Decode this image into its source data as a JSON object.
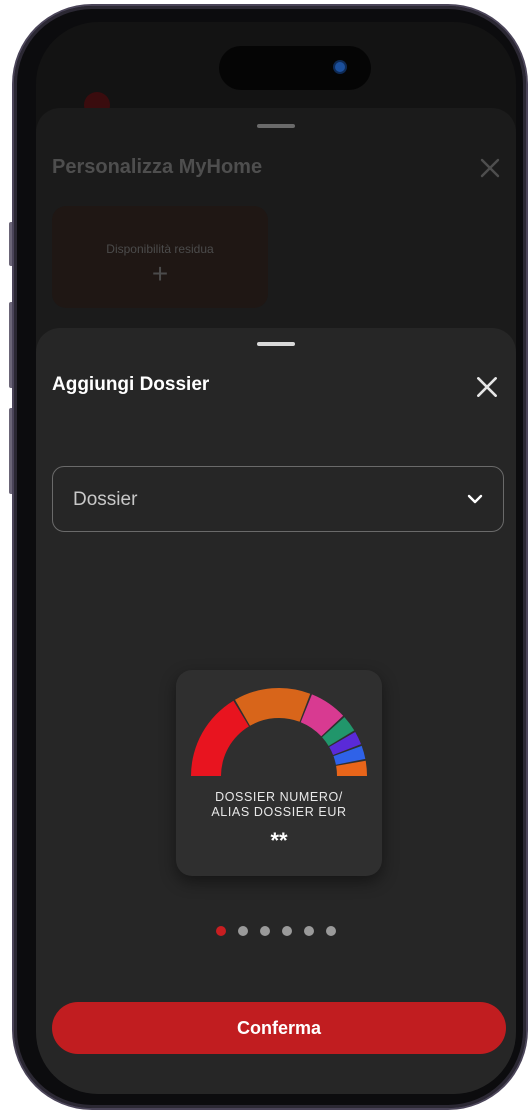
{
  "background_sheet": {
    "title": "Personalizza MyHome",
    "close_icon": "close-icon",
    "tile": {
      "label": "Disponibilità residua",
      "plus": "+"
    }
  },
  "sheet": {
    "title": "Aggiungi Dossier",
    "close_icon": "close-icon",
    "dropdown": {
      "value": "Dossier",
      "icon": "chevron-down-icon"
    },
    "card": {
      "label_line1": "DOSSIER NUMERO/",
      "label_line2": "ALIAS DOSSIER EUR",
      "value": "**",
      "gauge_colors": [
        "#e8141f",
        "#d8651a",
        "#d83a91",
        "#21966b",
        "#5a2ad8",
        "#2f62e8",
        "#e8651a"
      ]
    },
    "pagination": {
      "total": 6,
      "active": 0
    },
    "confirm_label": "Conferma"
  },
  "colors": {
    "accent": "#c11d20",
    "sheet_bg": "#262626"
  }
}
